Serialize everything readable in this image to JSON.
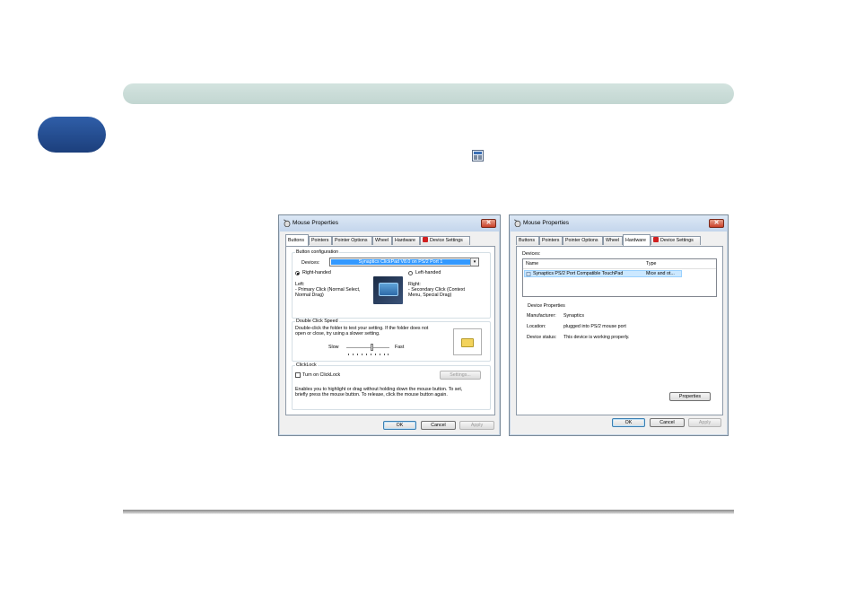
{
  "left_window": {
    "title": "Mouse Properties",
    "tabs": [
      "Buttons",
      "Pointers",
      "Pointer Options",
      "Wheel",
      "Hardware",
      "Device Settings"
    ],
    "active_tab": "Buttons",
    "button_configuration": {
      "legend": "Button configuration",
      "devices_label": "Devices:",
      "devices_value": "Synaptics ClickPad V8.0 on PS/2 Port 1",
      "right_handed_label": "Right-handed",
      "left_handed_label": "Left-handed",
      "left_desc_title": "Left:",
      "left_desc_1": "- Primary Click (Normal Select,",
      "left_desc_2": "Normal Drag)",
      "right_desc_title": "Right:",
      "right_desc_1": "- Secondary Click (Context",
      "right_desc_2": "Menu, Special Drag)"
    },
    "double_click": {
      "legend": "Double Click Speed",
      "desc_1": "Double-click the folder to test your setting.  If the folder does not",
      "desc_2": "open or close, try using a slower setting.",
      "slow_label": "Slow",
      "fast_label": "Fast",
      "speed_level": 0.6
    },
    "clicklock": {
      "legend": "ClickLock",
      "checkbox_label": "Turn on ClickLock",
      "settings_label": "Settings...",
      "desc_1": "Enables you to highlight or drag without holding down the mouse button.  To set,",
      "desc_2": "briefly press the mouse button.  To release, click the mouse button again."
    },
    "ok_label": "OK",
    "cancel_label": "Cancel",
    "apply_label": "Apply"
  },
  "right_window": {
    "title": "Mouse Properties",
    "tabs": [
      "Buttons",
      "Pointers",
      "Pointer Options",
      "Wheel",
      "Hardware",
      "Device Settings"
    ],
    "active_tab": "Hardware",
    "devices_label": "Devices:",
    "columns": [
      "Name",
      "Type"
    ],
    "rows": [
      {
        "name": "Synaptics PS/2 Port Compatible TouchPad",
        "type": "Mice and ot..."
      }
    ],
    "device_properties": {
      "heading": "Device Properties",
      "manufacturer_label": "Manufacturer:",
      "manufacturer_value": "Synaptics",
      "location_label": "Location:",
      "location_value": "plugged into PS/2 mouse port",
      "status_label": "Device status:",
      "status_value": "This device is working properly."
    },
    "properties_label": "Properties",
    "ok_label": "OK",
    "cancel_label": "Cancel",
    "apply_label": "Apply"
  },
  "colors": {
    "header_bar": "#c9dcd7",
    "chapter_tab": "#234a8e",
    "selection": "#3399ff",
    "close_button": "#c9402a"
  }
}
